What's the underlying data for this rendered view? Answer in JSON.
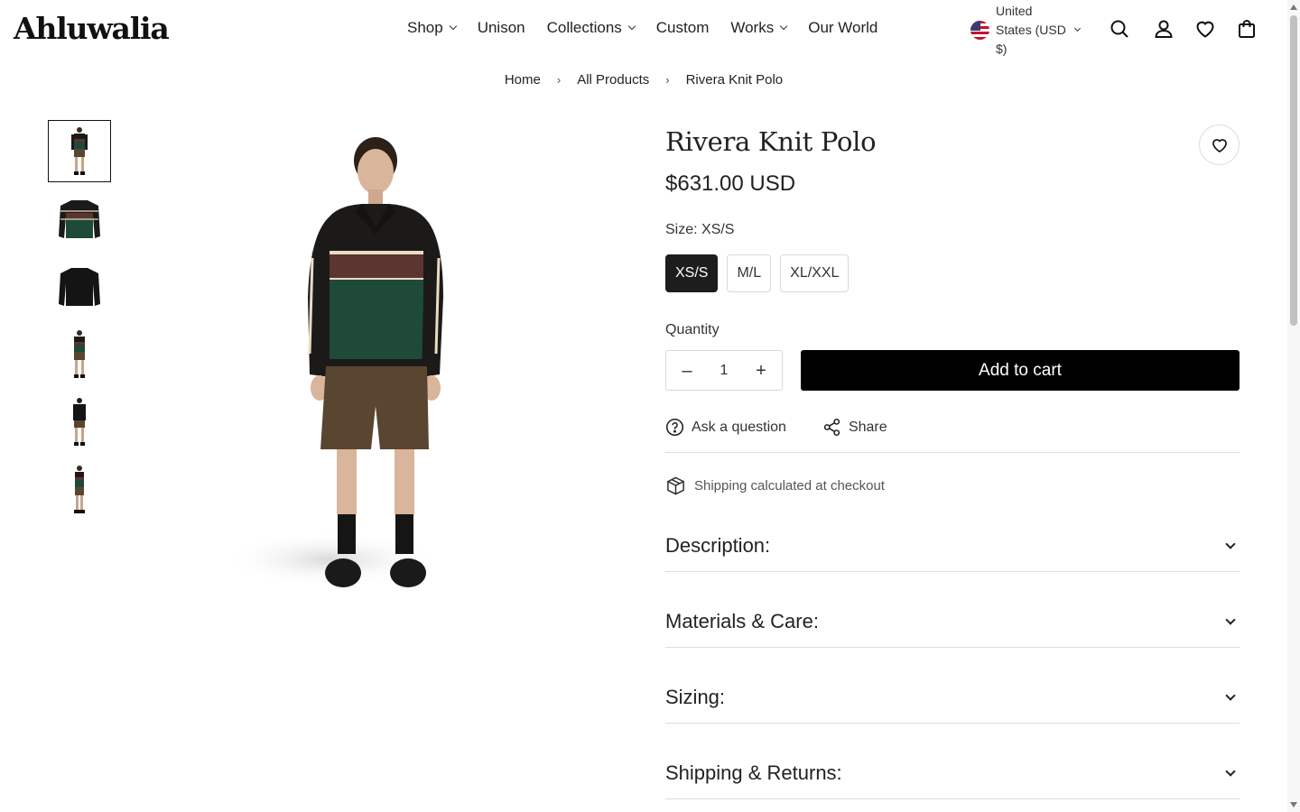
{
  "header": {
    "logo": "Ahluwalia",
    "nav": [
      {
        "label": "Shop",
        "has_dropdown": true
      },
      {
        "label": "Unison",
        "has_dropdown": false
      },
      {
        "label": "Collections",
        "has_dropdown": true
      },
      {
        "label": "Custom",
        "has_dropdown": false
      },
      {
        "label": "Works",
        "has_dropdown": true
      },
      {
        "label": "Our World",
        "has_dropdown": false
      }
    ],
    "currency": "United States (USD $)",
    "icons": [
      "search-icon",
      "account-icon",
      "wishlist-icon",
      "cart-icon"
    ]
  },
  "breadcrumb": [
    "Home",
    "All Products",
    "Rivera Knit Polo"
  ],
  "gallery": {
    "thumbnails": [
      "model-front",
      "polo-front",
      "polo-back",
      "model-angle",
      "model-back",
      "model-side"
    ],
    "active_index": 0
  },
  "product": {
    "title": "Rivera Knit Polo",
    "price": "$631.00 USD",
    "size_label": "Size: XS/S",
    "sizes": [
      "XS/S",
      "M/L",
      "XL/XXL"
    ],
    "selected_size": "XS/S",
    "quantity_label": "Quantity",
    "quantity": "1",
    "add_to_cart": "Add to cart",
    "ask_question": "Ask a question",
    "share": "Share",
    "shipping_note": "Shipping calculated at checkout",
    "accordions": [
      "Description:",
      "Materials & Care:",
      "Sizing:",
      "Shipping & Returns:"
    ]
  },
  "colors": {
    "primary": "#000000",
    "polo_green": "#1f4a38",
    "polo_brown": "#5b3530",
    "polo_black": "#1c1a18",
    "shorts": "#5a4530"
  }
}
